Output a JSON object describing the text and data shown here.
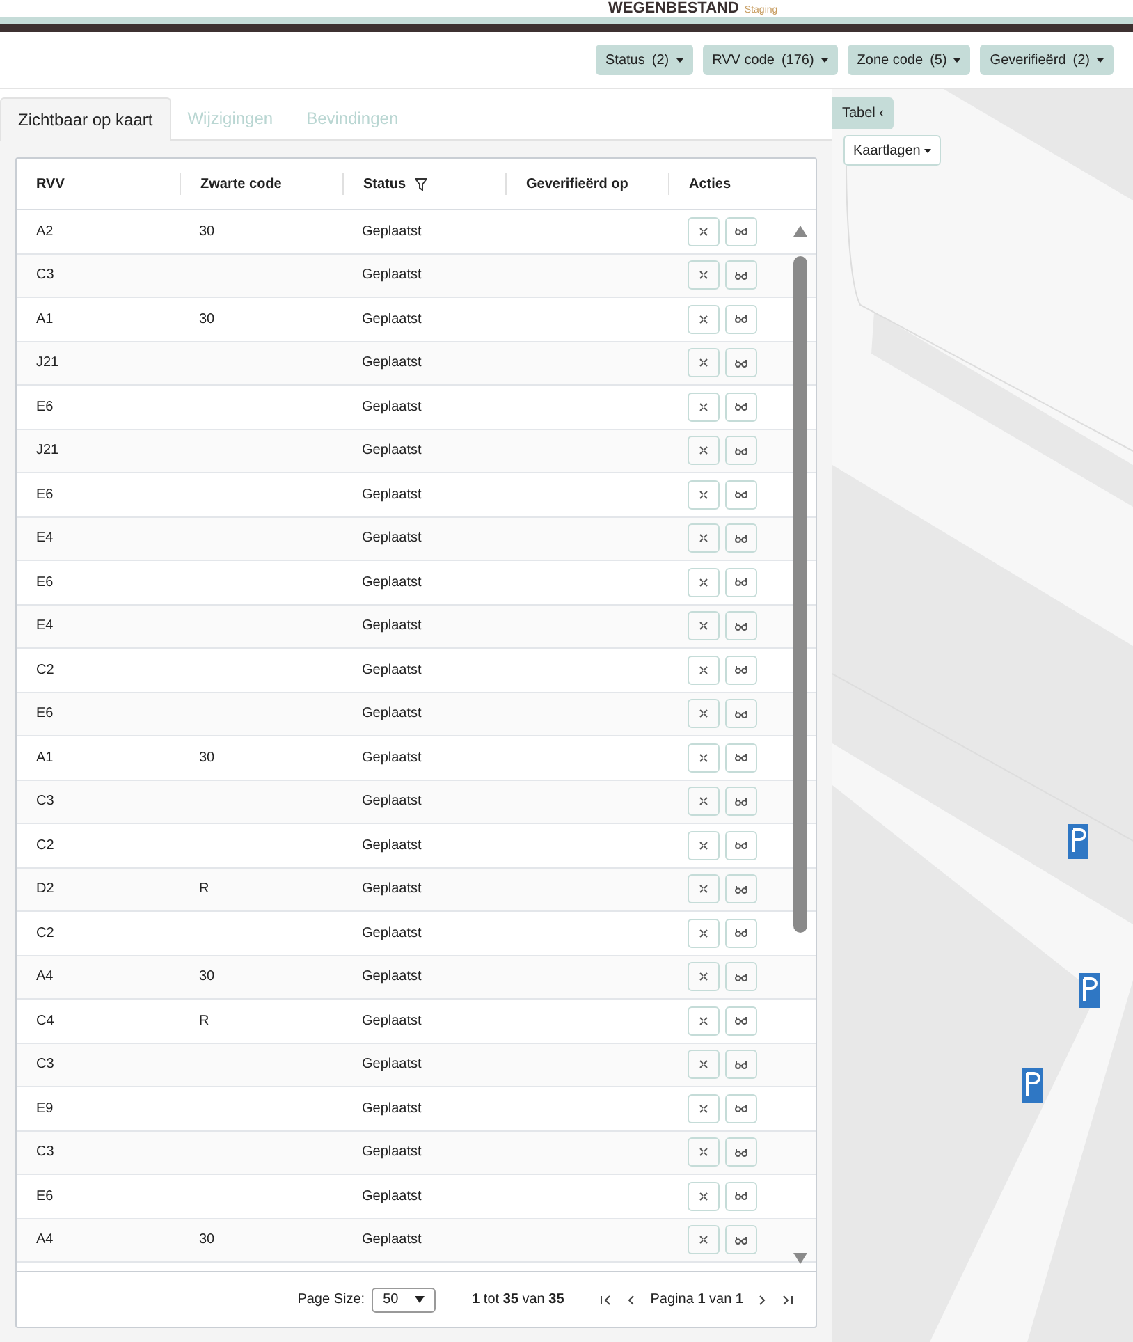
{
  "header": {
    "brand": "WEGENBESTAND",
    "environment": "Staging"
  },
  "filters": [
    {
      "label": "Status",
      "count": "(2)"
    },
    {
      "label": "RVV code",
      "count": "(176)"
    },
    {
      "label": "Zone code",
      "count": "(5)"
    },
    {
      "label": "Geverifieërd",
      "count": "(2)"
    }
  ],
  "tabs": [
    {
      "label": "Zichtbaar op kaart",
      "selected": true
    },
    {
      "label": "Wijzigingen",
      "selected": false
    },
    {
      "label": "Bevindingen",
      "selected": false
    }
  ],
  "table": {
    "columns": [
      {
        "label": "RVV",
        "filter": false
      },
      {
        "label": "Zwarte code",
        "filter": false
      },
      {
        "label": "Status",
        "filter": true
      },
      {
        "label": "Geverifieërd op",
        "filter": false
      },
      {
        "label": "Acties",
        "filter": false
      }
    ],
    "rows": [
      {
        "rvv": "A2",
        "code": "30",
        "status": "Geplaatst"
      },
      {
        "rvv": "C3",
        "code": "",
        "status": "Geplaatst"
      },
      {
        "rvv": "A1",
        "code": "30",
        "status": "Geplaatst"
      },
      {
        "rvv": "J21",
        "code": "",
        "status": "Geplaatst"
      },
      {
        "rvv": "E6",
        "code": "",
        "status": "Geplaatst"
      },
      {
        "rvv": "J21",
        "code": "",
        "status": "Geplaatst"
      },
      {
        "rvv": "E6",
        "code": "",
        "status": "Geplaatst"
      },
      {
        "rvv": "E4",
        "code": "",
        "status": "Geplaatst"
      },
      {
        "rvv": "E6",
        "code": "",
        "status": "Geplaatst"
      },
      {
        "rvv": "E4",
        "code": "",
        "status": "Geplaatst"
      },
      {
        "rvv": "C2",
        "code": "",
        "status": "Geplaatst"
      },
      {
        "rvv": "E6",
        "code": "",
        "status": "Geplaatst"
      },
      {
        "rvv": "A1",
        "code": "30",
        "status": "Geplaatst"
      },
      {
        "rvv": "C3",
        "code": "",
        "status": "Geplaatst"
      },
      {
        "rvv": "C2",
        "code": "",
        "status": "Geplaatst"
      },
      {
        "rvv": "D2",
        "code": "R",
        "status": "Geplaatst"
      },
      {
        "rvv": "C2",
        "code": "",
        "status": "Geplaatst"
      },
      {
        "rvv": "A4",
        "code": "30",
        "status": "Geplaatst"
      },
      {
        "rvv": "C4",
        "code": "R",
        "status": "Geplaatst"
      },
      {
        "rvv": "C3",
        "code": "",
        "status": "Geplaatst"
      },
      {
        "rvv": "E9",
        "code": "",
        "status": "Geplaatst"
      },
      {
        "rvv": "C3",
        "code": "",
        "status": "Geplaatst"
      },
      {
        "rvv": "E6",
        "code": "",
        "status": "Geplaatst"
      },
      {
        "rvv": "A4",
        "code": "30",
        "status": "Geplaatst"
      }
    ]
  },
  "pagination": {
    "page_size_label": "Page Size:",
    "page_size": "50",
    "range": "**1** tot **35** van **35**",
    "page": "Pagina **1** van **1**"
  },
  "map": {
    "table_toggle": "Tabel ‹",
    "layers_button": "Kaartlagen"
  }
}
